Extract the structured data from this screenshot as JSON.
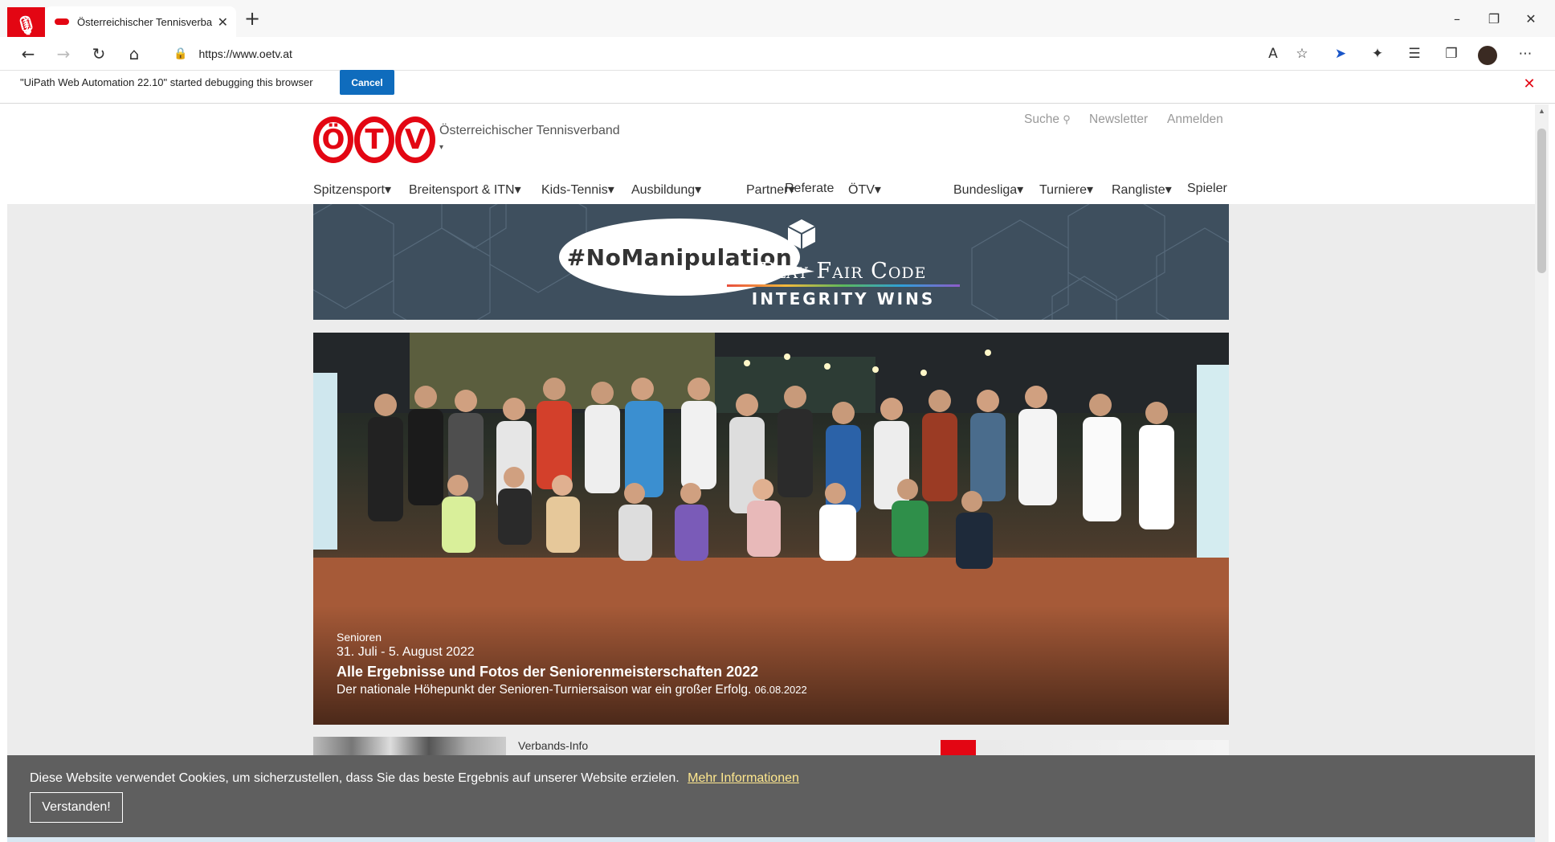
{
  "browser": {
    "tab_title": "Österreichischer Tennisverband",
    "new_tab": "+",
    "url": "https://www.oetv.at",
    "debug_message": "\"UiPath Web Automation 22.10\" started debugging this browser",
    "cancel_label": "Cancel",
    "window_controls": {
      "minimize": "–",
      "restore": "❐",
      "close": "✕"
    },
    "nav_icons": {
      "back": "←",
      "forward": "→",
      "refresh": "↻",
      "home": "⌂"
    },
    "toolbar_icons": [
      "read-aloud-icon",
      "favorite-add-icon",
      "copilot-icon",
      "extensions-icon",
      "favorites-icon",
      "collections-icon",
      "profile-avatar",
      "more-icon"
    ]
  },
  "site": {
    "logo_letters": [
      "Ö",
      "T",
      "V"
    ],
    "org_name": "Österreichischer Tennisverband",
    "org_caret": "▾",
    "top_links": {
      "search": "Suche",
      "search_icon": "🔍",
      "newsletter": "Newsletter",
      "login": "Anmelden"
    },
    "nav_left": [
      "Spitzensport▾",
      "Breitensport & ITN▾",
      "Kids-Tennis▾",
      "Ausbildung▾",
      "Partner▾",
      "Referate",
      "ÖTV▾"
    ],
    "nav_right": [
      "Bundesliga▾",
      "Turniere▾",
      "Rangliste▾",
      "Spieler"
    ],
    "banner": {
      "hashtag": "#NoManipulation",
      "line1": "Play Fair Code",
      "line2": "INTEGRITY WINS"
    },
    "hero": {
      "category": "Senioren",
      "date_range": "31. Juli - 5. August 2022",
      "title": "Alle Ergebnisse und Fotos der Seniorenmeisterschaften 2022",
      "subtitle": "Der nationale Höhepunkt der Senioren-Turniersaison war ein großer Erfolg.",
      "posted": "06.08.2022"
    },
    "section_label": "Verbands-Info"
  },
  "cookie": {
    "text": "Diese Website verwendet Cookies, um sicherzustellen, dass Sie das beste Ergebnis auf unserer Website erzielen.",
    "link": "Mehr Informationen",
    "button": "Verstanden!"
  },
  "colors": {
    "brand_red": "#e30613",
    "banner_bg": "#3e4f5e",
    "cookie_bg": "#5f5f5f",
    "accent_blue": "#0f6cbd"
  }
}
